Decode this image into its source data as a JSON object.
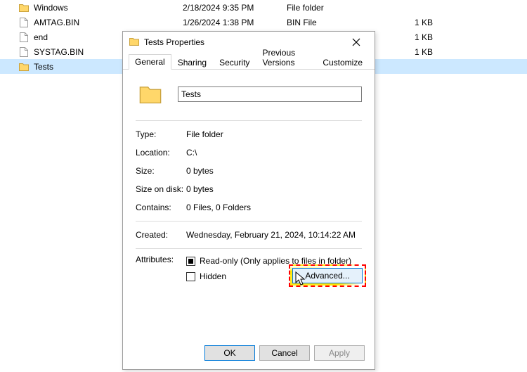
{
  "files": [
    {
      "name": "Windows",
      "date": "2/18/2024 9:35 PM",
      "type": "File folder",
      "size": "",
      "kind": "folder"
    },
    {
      "name": "AMTAG.BIN",
      "date": "1/26/2024 1:38 PM",
      "type": "BIN File",
      "size": "1 KB",
      "kind": "file"
    },
    {
      "name": "end",
      "date": "",
      "type": "",
      "size": "1 KB",
      "kind": "file"
    },
    {
      "name": "SYSTAG.BIN",
      "date": "",
      "type": "",
      "size": "1 KB",
      "kind": "file"
    },
    {
      "name": "Tests",
      "date": "",
      "type": "",
      "size": "",
      "kind": "folder"
    }
  ],
  "selected_index": 4,
  "dialog": {
    "title": "Tests Properties",
    "tabs": [
      "General",
      "Sharing",
      "Security",
      "Previous Versions",
      "Customize"
    ],
    "active_tab": 0,
    "name_value": "Tests",
    "props": {
      "type_label": "Type:",
      "type_value": "File folder",
      "loc_label": "Location:",
      "loc_value": "C:\\",
      "size_label": "Size:",
      "size_value": "0 bytes",
      "disk_label": "Size on disk:",
      "disk_value": "0 bytes",
      "cont_label": "Contains:",
      "cont_value": "0 Files, 0 Folders",
      "created_label": "Created:",
      "created_value": "Wednesday, February 21, 2024, 10:14:22 AM",
      "attr_label": "Attributes:",
      "readonly_label": "Read-only (Only applies to files in folder)",
      "hidden_label": "Hidden",
      "advanced_label": "Advanced..."
    },
    "buttons": {
      "ok": "OK",
      "cancel": "Cancel",
      "apply": "Apply"
    }
  }
}
